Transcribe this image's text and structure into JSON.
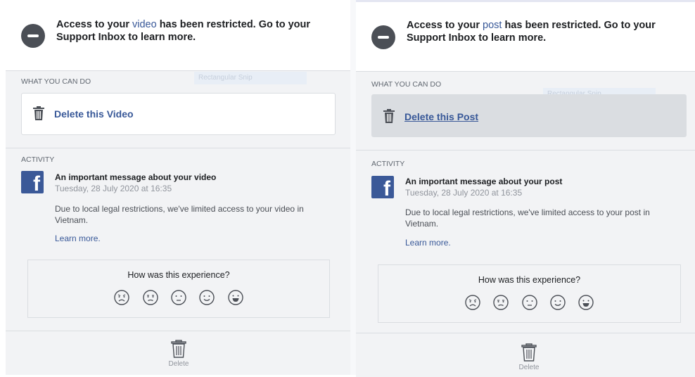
{
  "left": {
    "header": {
      "pre": "Access to your ",
      "link": "video",
      "post": " has been restricted. Go to your Support Inbox to learn more."
    },
    "what_label": "WHAT YOU CAN DO",
    "snip_ghost": "Rectangular Snip",
    "action_label": "Delete this Video",
    "activity_label": "ACTIVITY",
    "message": {
      "title": "An important message about your video",
      "date": "Tuesday, 28 July 2020 at 16:35",
      "body": "Due to local legal restrictions, we've limited access to your video in Vietnam.",
      "learn_more": "Learn more."
    },
    "feedback_question": "How was this experience?",
    "footer_label": "Delete"
  },
  "right": {
    "header": {
      "pre": "Access to your ",
      "link": "post",
      "post": " has been restricted. Go to your Support Inbox to learn more."
    },
    "what_label": "WHAT YOU CAN DO",
    "snip_ghost": "Rectangular Snip",
    "action_label": "Delete this Post",
    "activity_label": "ACTIVITY",
    "message": {
      "title": "An important message about your post",
      "date": "Tuesday, 28 July 2020 at 16:35",
      "body": "Due to local legal restrictions, we've limited access to your post in Vietnam.",
      "learn_more": "Learn more."
    },
    "feedback_question": "How was this experience?",
    "footer_label": "Delete"
  },
  "icons": [
    "restricted-icon",
    "trash-icon",
    "facebook-logo-icon",
    "very-sad-face-icon",
    "sad-face-icon",
    "neutral-face-icon",
    "happy-face-icon",
    "very-happy-face-icon"
  ],
  "colors": {
    "link": "#385898",
    "facebook_blue": "#3b5998",
    "icon_gray": "#4b4f56",
    "panel_bg": "#f2f3f5"
  }
}
